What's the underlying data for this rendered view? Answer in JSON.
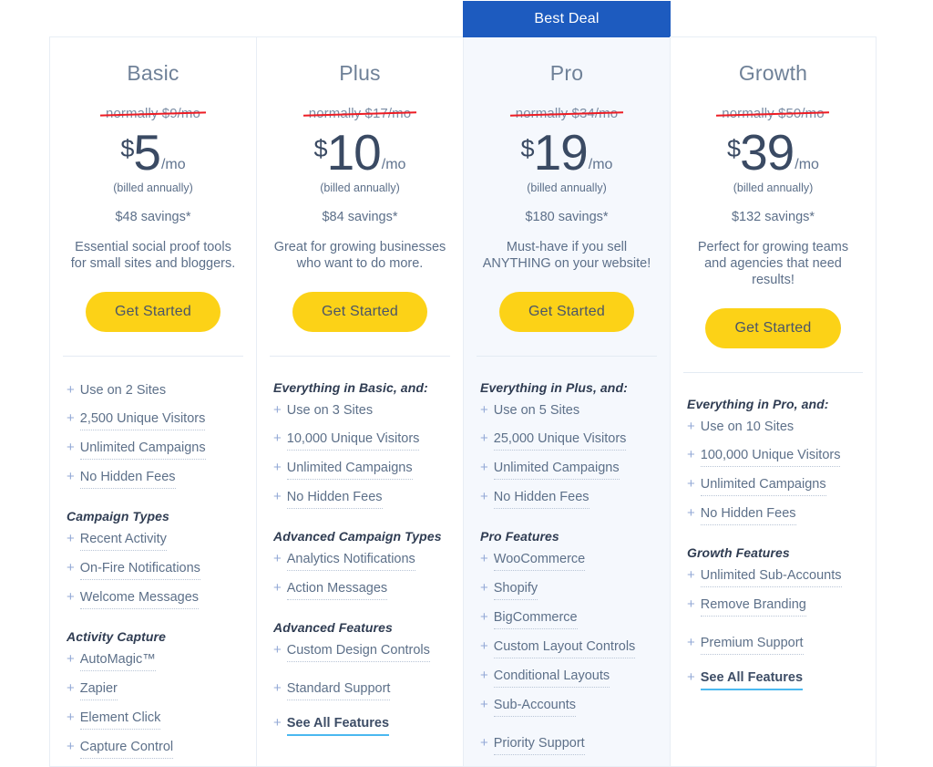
{
  "colors": {
    "ribbon_bg": "#1d5bbf",
    "cta_bg": "#fcd217",
    "strike": "#ed1c24",
    "featured_bg": "#f5f8fd",
    "plus": "#93a9d6",
    "see_all_underline": "#4ab8f0"
  },
  "labels": {
    "best_deal": "Best Deal",
    "per_month": "/mo",
    "billed": "(billed annually)",
    "cta": "Get Started",
    "plus_sign": "+"
  },
  "plans": [
    {
      "name": "Basic",
      "normally": "normally $9/mo",
      "currency": "$",
      "amount": "5",
      "per": "/mo",
      "billed": "(billed annually)",
      "savings": "$48 savings*",
      "blurb": "Essential social proof tools for small sites and bloggers.",
      "cta": "Get Started",
      "featured": false,
      "ribbon": "",
      "groups": [
        {
          "title": "",
          "items": [
            {
              "label": "Use on 2 Sites",
              "dotted": false
            },
            {
              "label": "2,500 Unique Visitors",
              "dotted": true
            },
            {
              "label": "Unlimited Campaigns",
              "dotted": true
            },
            {
              "label": "No Hidden Fees",
              "dotted": true
            }
          ]
        },
        {
          "title": "Campaign Types",
          "items": [
            {
              "label": "Recent Activity",
              "dotted": true
            },
            {
              "label": "On-Fire Notifications",
              "dotted": true
            },
            {
              "label": "Welcome Messages",
              "dotted": true
            }
          ]
        },
        {
          "title": "Activity Capture",
          "items": [
            {
              "label": "AutoMagic™",
              "dotted": true
            },
            {
              "label": "Zapier",
              "dotted": true
            },
            {
              "label": "Element Click",
              "dotted": true
            },
            {
              "label": "Capture Control",
              "dotted": true
            }
          ]
        }
      ]
    },
    {
      "name": "Plus",
      "normally": "normally $17/mo",
      "currency": "$",
      "amount": "10",
      "per": "/mo",
      "billed": "(billed annually)",
      "savings": "$84 savings*",
      "blurb": "Great for growing businesses who want to do more.",
      "cta": "Get Started",
      "featured": false,
      "ribbon": "",
      "groups": [
        {
          "title": "Everything in Basic, and:",
          "items": [
            {
              "label": "Use on 3 Sites",
              "dotted": false
            },
            {
              "label": "10,000 Unique Visitors",
              "dotted": true
            },
            {
              "label": "Unlimited Campaigns",
              "dotted": true
            },
            {
              "label": "No Hidden Fees",
              "dotted": true
            }
          ]
        },
        {
          "title": "Advanced Campaign Types",
          "items": [
            {
              "label": "Analytics Notifications",
              "dotted": true
            },
            {
              "label": "Action Messages",
              "dotted": true
            }
          ]
        },
        {
          "title": "Advanced Features",
          "items": [
            {
              "label": "Custom Design Controls",
              "dotted": true
            },
            {
              "label": "Standard Support",
              "dotted": true,
              "gap": true
            },
            {
              "label": "See All Features",
              "see_all": true
            }
          ]
        }
      ]
    },
    {
      "name": "Pro",
      "normally": "normally $34/mo",
      "currency": "$",
      "amount": "19",
      "per": "/mo",
      "billed": "(billed annually)",
      "savings": "$180 savings*",
      "blurb": "Must-have if you sell ANYTHING on your website!",
      "cta": "Get Started",
      "featured": true,
      "ribbon": "Best Deal",
      "groups": [
        {
          "title": "Everything in Plus, and:",
          "items": [
            {
              "label": "Use on 5 Sites",
              "dotted": false
            },
            {
              "label": "25,000 Unique Visitors",
              "dotted": true
            },
            {
              "label": "Unlimited Campaigns",
              "dotted": true
            },
            {
              "label": "No Hidden Fees",
              "dotted": true
            }
          ]
        },
        {
          "title": "Pro Features",
          "items": [
            {
              "label": "WooCommerce",
              "dotted": true
            },
            {
              "label": "Shopify",
              "dotted": true
            },
            {
              "label": "BigCommerce",
              "dotted": true
            },
            {
              "label": "Custom Layout Controls",
              "dotted": true
            },
            {
              "label": "Conditional Layouts",
              "dotted": true
            },
            {
              "label": "Sub-Accounts",
              "dotted": true
            },
            {
              "label": "Priority Support",
              "dotted": true,
              "gap": true
            }
          ]
        }
      ]
    },
    {
      "name": "Growth",
      "normally": "normally $50/mo",
      "currency": "$",
      "amount": "39",
      "per": "/mo",
      "billed": "(billed annually)",
      "savings": "$132 savings*",
      "blurb": "Perfect for growing teams and agencies that need results!",
      "cta": "Get Started",
      "featured": false,
      "ribbon": "",
      "groups": [
        {
          "title": "Everything in Pro, and:",
          "items": [
            {
              "label": "Use on 10 Sites",
              "dotted": false
            },
            {
              "label": "100,000 Unique Visitors",
              "dotted": true
            },
            {
              "label": "Unlimited Campaigns",
              "dotted": true
            },
            {
              "label": "No Hidden Fees",
              "dotted": true
            }
          ]
        },
        {
          "title": "Growth Features",
          "items": [
            {
              "label": "Unlimited Sub-Accounts",
              "dotted": true
            },
            {
              "label": "Remove Branding",
              "dotted": true
            },
            {
              "label": "Premium Support",
              "dotted": true,
              "gap": true
            },
            {
              "label": "See All Features",
              "see_all": true
            }
          ]
        }
      ]
    }
  ]
}
